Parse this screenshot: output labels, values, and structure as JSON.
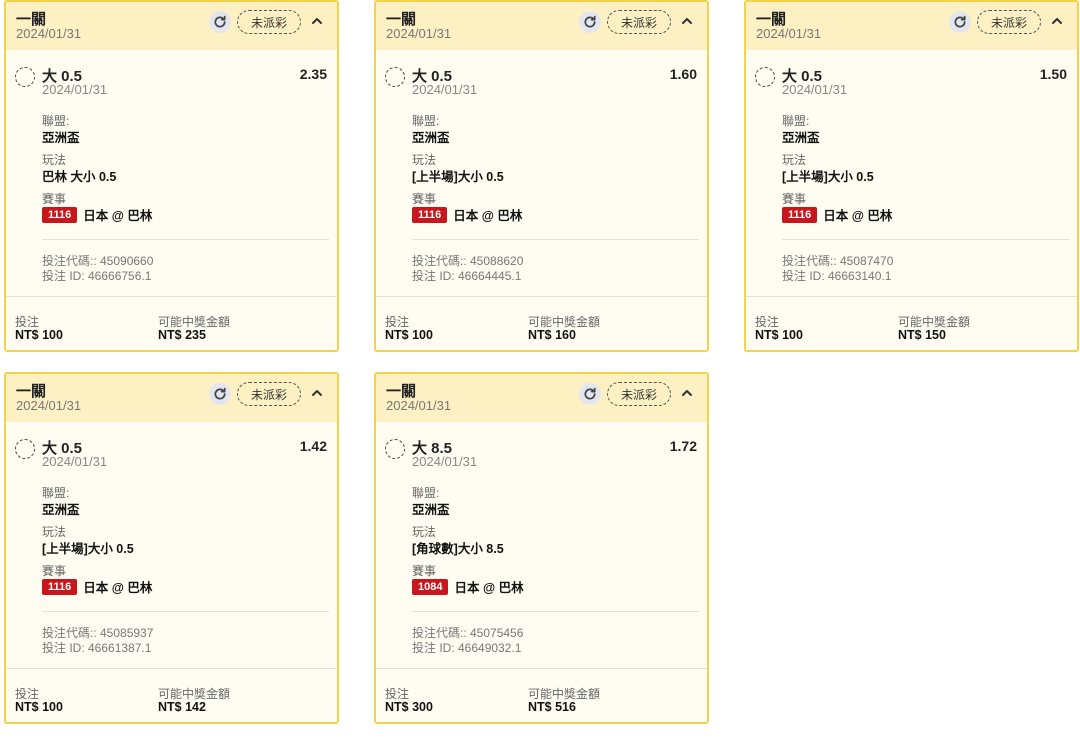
{
  "bets": [
    {
      "title": "一關",
      "date": "2024/01/31",
      "status": "未派彩",
      "selection": "大 0.5",
      "selection_date": "2024/01/31",
      "odds": "2.35",
      "league_label": "聯盟:",
      "league": "亞洲盃",
      "market_label": "玩法",
      "market": "巴林 大小 0.5",
      "event_label": "賽事",
      "match_id": "1116",
      "match": "日本 @ 巴林",
      "bet_code": "投注代碼:: 45090660",
      "bet_id": "投注 ID: 46666756.1",
      "stake_label": "投注",
      "stake": "NT$ 100",
      "payout_label": "可能中獎金額",
      "payout": "NT$ 235"
    },
    {
      "title": "一關",
      "date": "2024/01/31",
      "status": "未派彩",
      "selection": "大 0.5",
      "selection_date": "2024/01/31",
      "odds": "1.60",
      "league_label": "聯盟:",
      "league": "亞洲盃",
      "market_label": "玩法",
      "market": "[上半場]大小 0.5",
      "event_label": "賽事",
      "match_id": "1116",
      "match": "日本 @ 巴林",
      "bet_code": "投注代碼:: 45088620",
      "bet_id": "投注 ID: 46664445.1",
      "stake_label": "投注",
      "stake": "NT$ 100",
      "payout_label": "可能中獎金額",
      "payout": "NT$ 160"
    },
    {
      "title": "一關",
      "date": "2024/01/31",
      "status": "未派彩",
      "selection": "大 0.5",
      "selection_date": "2024/01/31",
      "odds": "1.50",
      "league_label": "聯盟:",
      "league": "亞洲盃",
      "market_label": "玩法",
      "market": "[上半場]大小 0.5",
      "event_label": "賽事",
      "match_id": "1116",
      "match": "日本 @ 巴林",
      "bet_code": "投注代碼:: 45087470",
      "bet_id": "投注 ID: 46663140.1",
      "stake_label": "投注",
      "stake": "NT$ 100",
      "payout_label": "可能中獎金額",
      "payout": "NT$ 150"
    },
    {
      "title": "一關",
      "date": "2024/01/31",
      "status": "未派彩",
      "selection": "大 0.5",
      "selection_date": "2024/01/31",
      "odds": "1.42",
      "league_label": "聯盟:",
      "league": "亞洲盃",
      "market_label": "玩法",
      "market": "[上半場]大小 0.5",
      "event_label": "賽事",
      "match_id": "1116",
      "match": "日本 @ 巴林",
      "bet_code": "投注代碼:: 45085937",
      "bet_id": "投注 ID: 46661387.1",
      "stake_label": "投注",
      "stake": "NT$ 100",
      "payout_label": "可能中獎金額",
      "payout": "NT$ 142"
    },
    {
      "title": "一關",
      "date": "2024/01/31",
      "status": "未派彩",
      "selection": "大 8.5",
      "selection_date": "2024/01/31",
      "odds": "1.72",
      "league_label": "聯盟:",
      "league": "亞洲盃",
      "market_label": "玩法",
      "market": "[角球數]大小 8.5",
      "event_label": "賽事",
      "match_id": "1084",
      "match": "日本 @ 巴林",
      "bet_code": "投注代碼:: 45075456",
      "bet_id": "投注 ID: 46649032.1",
      "stake_label": "投注",
      "stake": "NT$ 300",
      "payout_label": "可能中獎金額",
      "payout": "NT$ 516"
    }
  ],
  "icons": {
    "refresh": "refresh-icon",
    "collapse": "chevron-up-icon",
    "select": "radio-circle-icon"
  },
  "colors": {
    "card_border": "#f2d34b",
    "header_bg": "#fdf1c4",
    "match_badge": "#c8161d"
  }
}
